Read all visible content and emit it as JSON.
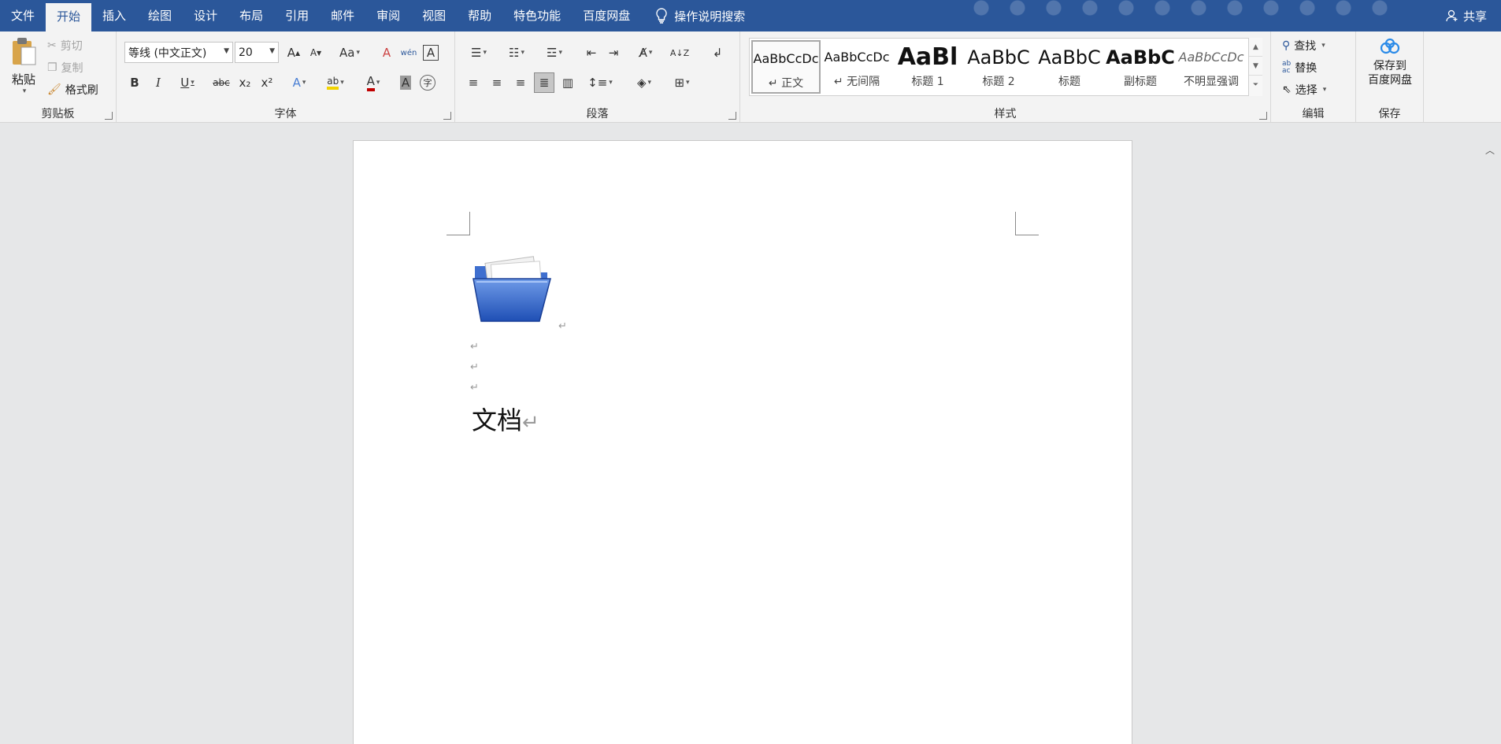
{
  "menu": {
    "tabs": [
      "文件",
      "开始",
      "插入",
      "绘图",
      "设计",
      "布局",
      "引用",
      "邮件",
      "审阅",
      "视图",
      "帮助",
      "特色功能",
      "百度网盘"
    ],
    "tell_me": "操作说明搜索",
    "share": "共享",
    "colors": {
      "bar": "#2b579a",
      "active_text": "#2b579a"
    }
  },
  "clipboard": {
    "paste": "粘贴",
    "cut": "剪切",
    "copy": "复制",
    "format_painter": "格式刷",
    "label": "剪贴板"
  },
  "font": {
    "name": "等线 (中文正文)",
    "size": "20",
    "label": "字体",
    "buttons": {
      "grow": "A",
      "shrink": "A",
      "change_case": "Aa",
      "clear": "A",
      "phonetic": "wén",
      "border": "A",
      "bold": "B",
      "italic": "I",
      "underline": "U",
      "strike": "abc",
      "subscript": "x₂",
      "superscript": "x²",
      "effects": "A",
      "highlight": "ab",
      "color": "A",
      "shading": "A",
      "enclose": "字"
    }
  },
  "paragraph": {
    "label": "段落"
  },
  "styles": {
    "label": "样式",
    "items": [
      {
        "sample": "AaBbCcDc",
        "name": "正文"
      },
      {
        "sample": "AaBbCcDc",
        "name": "无间隔"
      },
      {
        "sample": "AaBl",
        "name": "标题 1"
      },
      {
        "sample": "AaBbC",
        "name": "标题 2"
      },
      {
        "sample": "AaBbC",
        "name": "标题"
      },
      {
        "sample": "AaBbC",
        "name": "副标题"
      },
      {
        "sample": "AaBbCcDc",
        "name": "不明显强调"
      }
    ]
  },
  "editing": {
    "find": "查找",
    "replace": "替换",
    "select": "选择",
    "label": "编辑"
  },
  "save": {
    "button": "保存到\n百度网盘",
    "line1": "保存到",
    "line2": "百度网盘",
    "label": "保存"
  },
  "document": {
    "text": "文档",
    "paragraph_mark": "↵"
  }
}
